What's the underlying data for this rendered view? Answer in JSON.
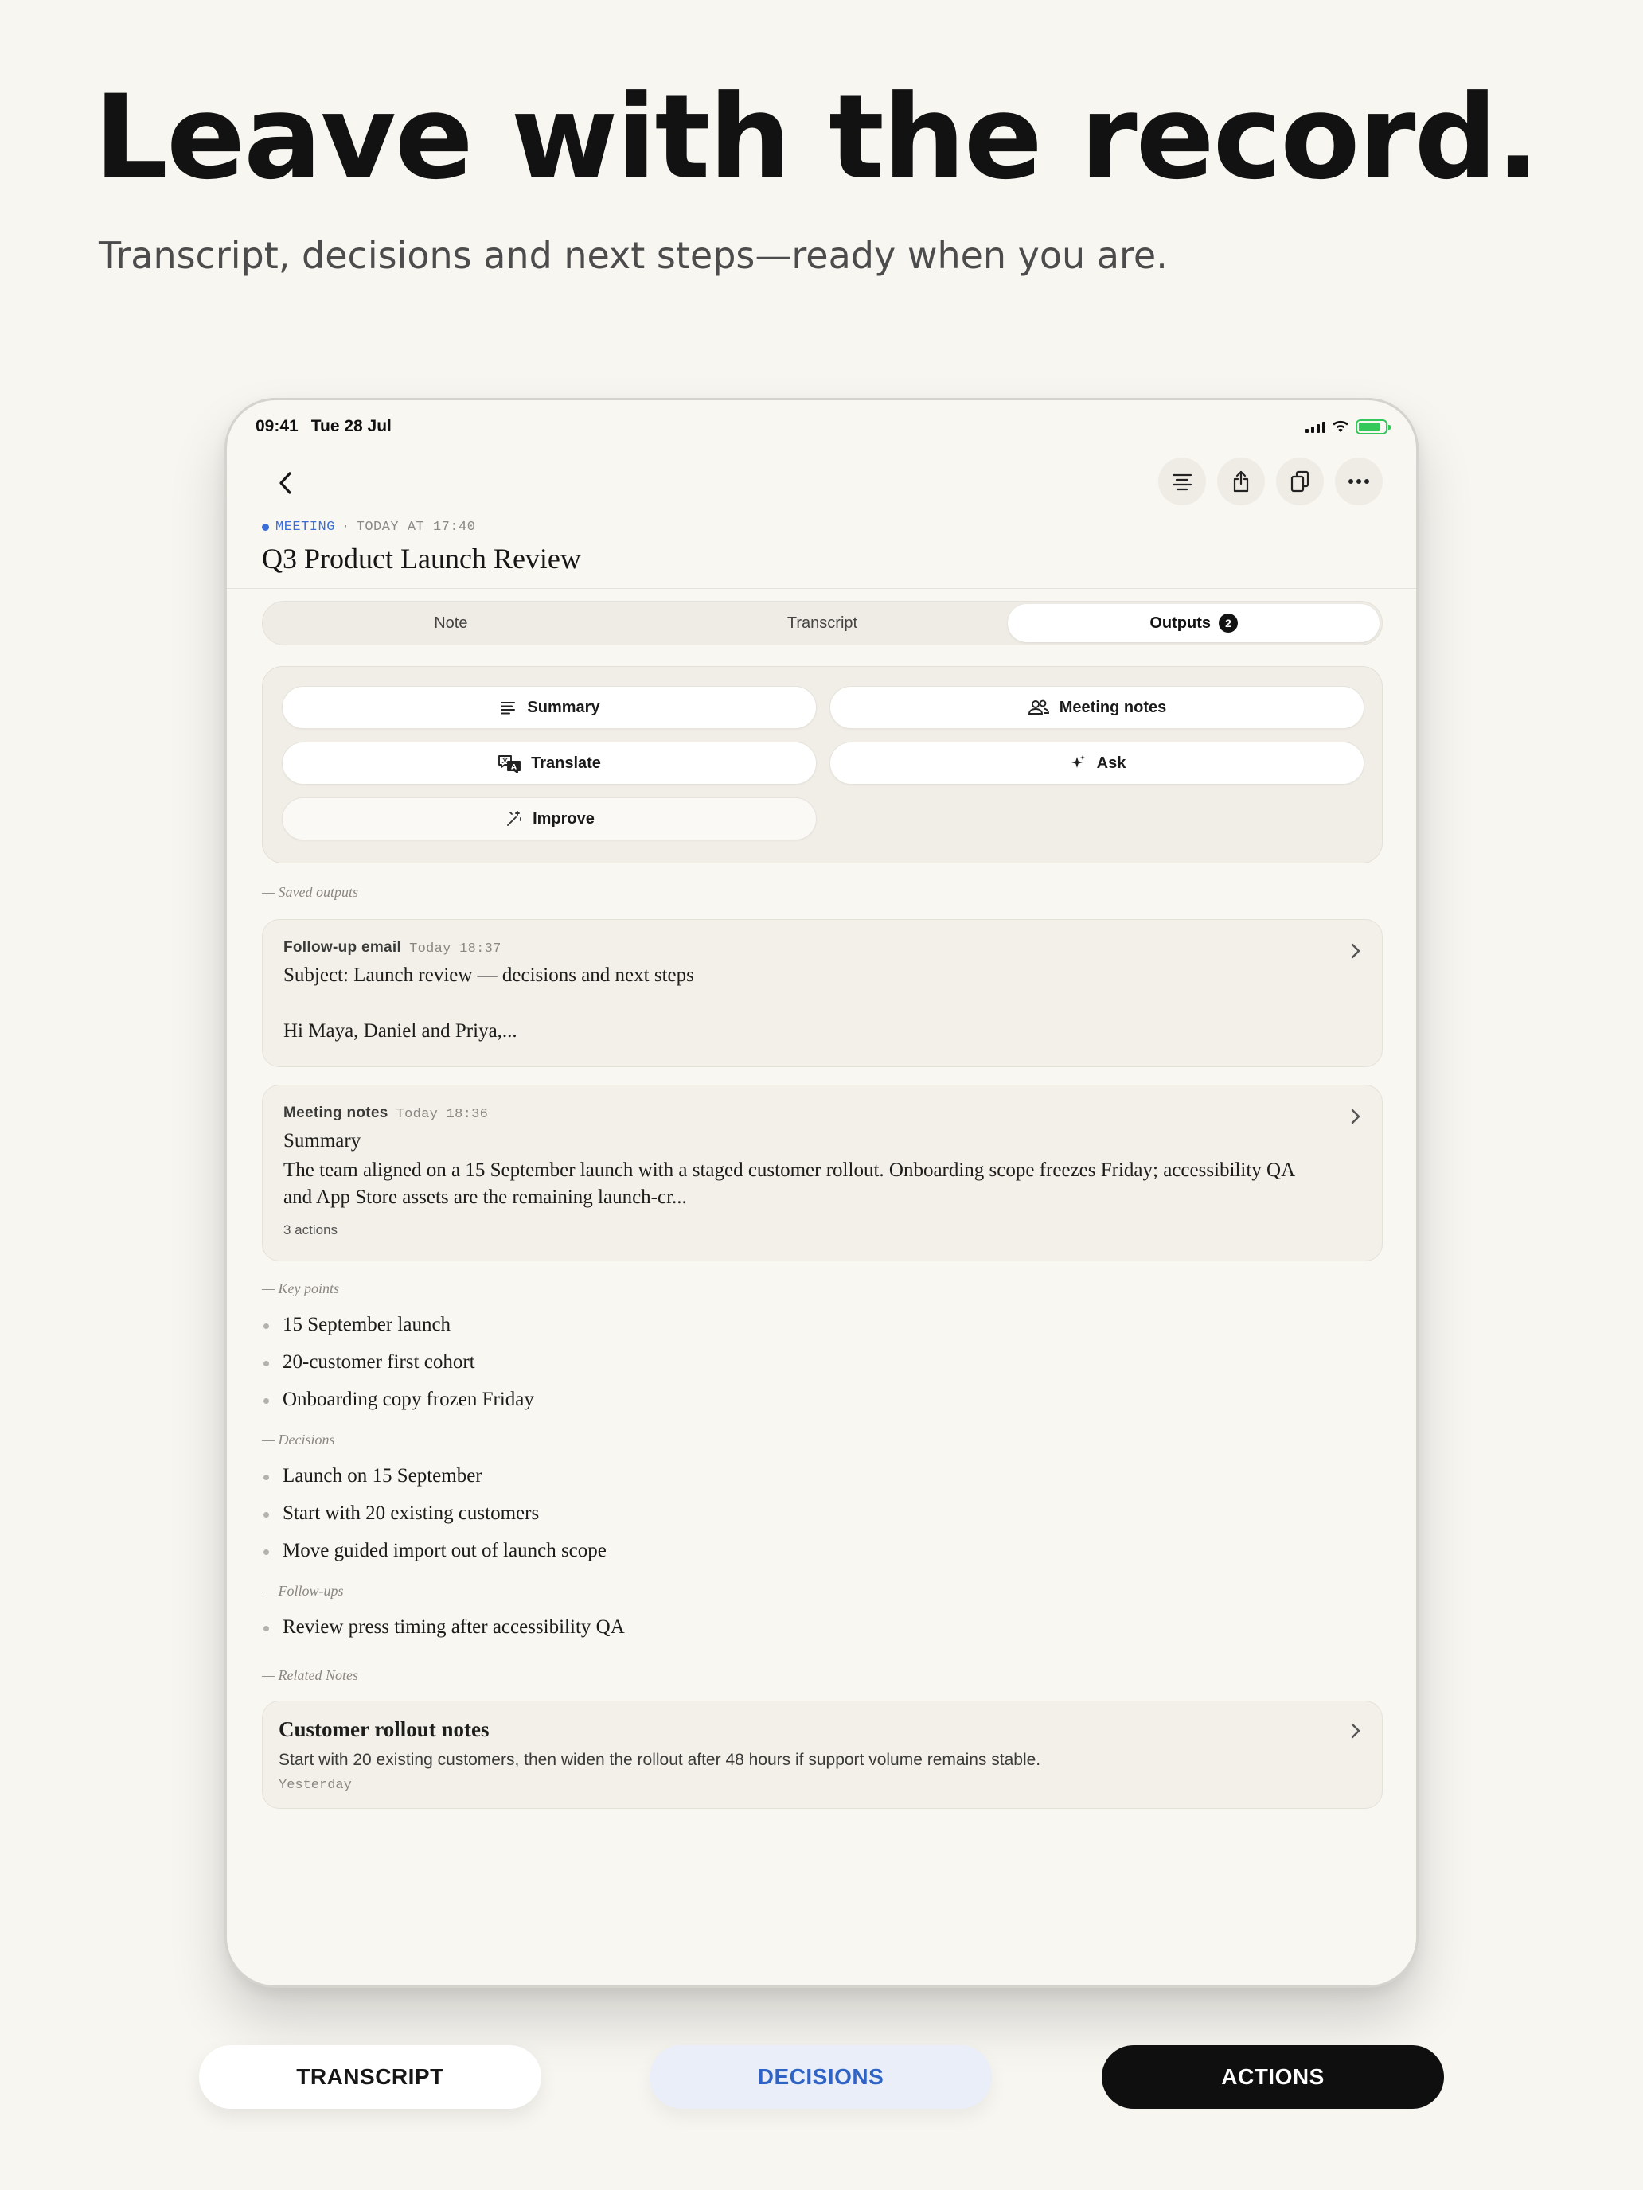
{
  "headline": "Leave with the record.",
  "subheadline": "Transcript, decisions and next steps—ready when you are.",
  "device": {
    "status": {
      "time": "09:41",
      "date": "Tue 28 Jul"
    },
    "meta": {
      "tag": "MEETING",
      "separator": "·",
      "when": "TODAY AT 17:40"
    },
    "title": "Q3 Product Launch Review",
    "tabs": [
      {
        "label": "Note"
      },
      {
        "label": "Transcript"
      },
      {
        "label": "Outputs",
        "badge": "2"
      }
    ],
    "output_actions": {
      "summary": "Summary",
      "meeting_notes": "Meeting notes",
      "translate": "Translate",
      "ask": "Ask",
      "improve": "Improve"
    },
    "saved_outputs_label": "— Saved outputs",
    "saved_outputs": [
      {
        "kind": "Follow-up email",
        "stamp": "Today 18:37",
        "subject": "Subject: Launch review — decisions and next steps",
        "preview": "Hi Maya, Daniel and Priya,..."
      },
      {
        "kind": "Meeting notes",
        "stamp": "Today 18:36",
        "heading": "Summary",
        "preview": "The team aligned on a 15 September launch with a staged customer rollout. Onboarding scope freezes Friday; accessibility QA and App Store assets are the remaining launch-cr...",
        "footer": "3 actions"
      }
    ],
    "key_points_label": "— Key points",
    "key_points": [
      "15 September launch",
      "20-customer first cohort",
      "Onboarding copy frozen Friday"
    ],
    "decisions_label": "— Decisions",
    "decisions": [
      "Launch on 15 September",
      "Start with 20 existing customers",
      "Move guided import out of launch scope"
    ],
    "followups_label": "— Follow-ups",
    "followups": [
      "Review press timing after accessibility QA"
    ],
    "related_label": "— Related Notes",
    "related": {
      "title": "Customer rollout notes",
      "body": "Start with 20 existing customers, then widen the rollout after 48 hours if support volume remains stable.",
      "stamp": "Yesterday"
    }
  },
  "pills": [
    "TRANSCRIPT",
    "DECISIONS",
    "ACTIONS"
  ],
  "colors": {
    "accent_blue": "#3b6fd6",
    "background": "#f8f6f1",
    "battery_green": "#34c759"
  }
}
